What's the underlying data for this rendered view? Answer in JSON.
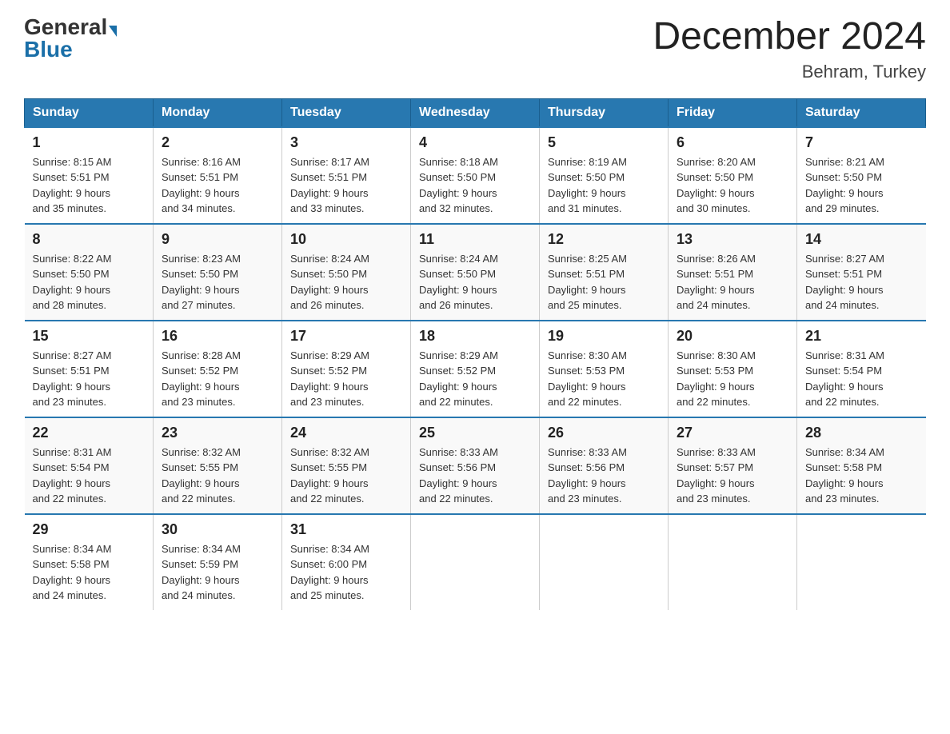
{
  "header": {
    "logo_general": "General",
    "logo_blue": "Blue",
    "month_title": "December 2024",
    "location": "Behram, Turkey"
  },
  "days_of_week": [
    "Sunday",
    "Monday",
    "Tuesday",
    "Wednesday",
    "Thursday",
    "Friday",
    "Saturday"
  ],
  "weeks": [
    [
      {
        "day": "1",
        "sunrise": "8:15 AM",
        "sunset": "5:51 PM",
        "daylight": "9 hours and 35 minutes."
      },
      {
        "day": "2",
        "sunrise": "8:16 AM",
        "sunset": "5:51 PM",
        "daylight": "9 hours and 34 minutes."
      },
      {
        "day": "3",
        "sunrise": "8:17 AM",
        "sunset": "5:51 PM",
        "daylight": "9 hours and 33 minutes."
      },
      {
        "day": "4",
        "sunrise": "8:18 AM",
        "sunset": "5:50 PM",
        "daylight": "9 hours and 32 minutes."
      },
      {
        "day": "5",
        "sunrise": "8:19 AM",
        "sunset": "5:50 PM",
        "daylight": "9 hours and 31 minutes."
      },
      {
        "day": "6",
        "sunrise": "8:20 AM",
        "sunset": "5:50 PM",
        "daylight": "9 hours and 30 minutes."
      },
      {
        "day": "7",
        "sunrise": "8:21 AM",
        "sunset": "5:50 PM",
        "daylight": "9 hours and 29 minutes."
      }
    ],
    [
      {
        "day": "8",
        "sunrise": "8:22 AM",
        "sunset": "5:50 PM",
        "daylight": "9 hours and 28 minutes."
      },
      {
        "day": "9",
        "sunrise": "8:23 AM",
        "sunset": "5:50 PM",
        "daylight": "9 hours and 27 minutes."
      },
      {
        "day": "10",
        "sunrise": "8:24 AM",
        "sunset": "5:50 PM",
        "daylight": "9 hours and 26 minutes."
      },
      {
        "day": "11",
        "sunrise": "8:24 AM",
        "sunset": "5:50 PM",
        "daylight": "9 hours and 26 minutes."
      },
      {
        "day": "12",
        "sunrise": "8:25 AM",
        "sunset": "5:51 PM",
        "daylight": "9 hours and 25 minutes."
      },
      {
        "day": "13",
        "sunrise": "8:26 AM",
        "sunset": "5:51 PM",
        "daylight": "9 hours and 24 minutes."
      },
      {
        "day": "14",
        "sunrise": "8:27 AM",
        "sunset": "5:51 PM",
        "daylight": "9 hours and 24 minutes."
      }
    ],
    [
      {
        "day": "15",
        "sunrise": "8:27 AM",
        "sunset": "5:51 PM",
        "daylight": "9 hours and 23 minutes."
      },
      {
        "day": "16",
        "sunrise": "8:28 AM",
        "sunset": "5:52 PM",
        "daylight": "9 hours and 23 minutes."
      },
      {
        "day": "17",
        "sunrise": "8:29 AM",
        "sunset": "5:52 PM",
        "daylight": "9 hours and 23 minutes."
      },
      {
        "day": "18",
        "sunrise": "8:29 AM",
        "sunset": "5:52 PM",
        "daylight": "9 hours and 22 minutes."
      },
      {
        "day": "19",
        "sunrise": "8:30 AM",
        "sunset": "5:53 PM",
        "daylight": "9 hours and 22 minutes."
      },
      {
        "day": "20",
        "sunrise": "8:30 AM",
        "sunset": "5:53 PM",
        "daylight": "9 hours and 22 minutes."
      },
      {
        "day": "21",
        "sunrise": "8:31 AM",
        "sunset": "5:54 PM",
        "daylight": "9 hours and 22 minutes."
      }
    ],
    [
      {
        "day": "22",
        "sunrise": "8:31 AM",
        "sunset": "5:54 PM",
        "daylight": "9 hours and 22 minutes."
      },
      {
        "day": "23",
        "sunrise": "8:32 AM",
        "sunset": "5:55 PM",
        "daylight": "9 hours and 22 minutes."
      },
      {
        "day": "24",
        "sunrise": "8:32 AM",
        "sunset": "5:55 PM",
        "daylight": "9 hours and 22 minutes."
      },
      {
        "day": "25",
        "sunrise": "8:33 AM",
        "sunset": "5:56 PM",
        "daylight": "9 hours and 22 minutes."
      },
      {
        "day": "26",
        "sunrise": "8:33 AM",
        "sunset": "5:56 PM",
        "daylight": "9 hours and 23 minutes."
      },
      {
        "day": "27",
        "sunrise": "8:33 AM",
        "sunset": "5:57 PM",
        "daylight": "9 hours and 23 minutes."
      },
      {
        "day": "28",
        "sunrise": "8:34 AM",
        "sunset": "5:58 PM",
        "daylight": "9 hours and 23 minutes."
      }
    ],
    [
      {
        "day": "29",
        "sunrise": "8:34 AM",
        "sunset": "5:58 PM",
        "daylight": "9 hours and 24 minutes."
      },
      {
        "day": "30",
        "sunrise": "8:34 AM",
        "sunset": "5:59 PM",
        "daylight": "9 hours and 24 minutes."
      },
      {
        "day": "31",
        "sunrise": "8:34 AM",
        "sunset": "6:00 PM",
        "daylight": "9 hours and 25 minutes."
      },
      null,
      null,
      null,
      null
    ]
  ],
  "labels": {
    "sunrise": "Sunrise:",
    "sunset": "Sunset:",
    "daylight": "Daylight:"
  }
}
